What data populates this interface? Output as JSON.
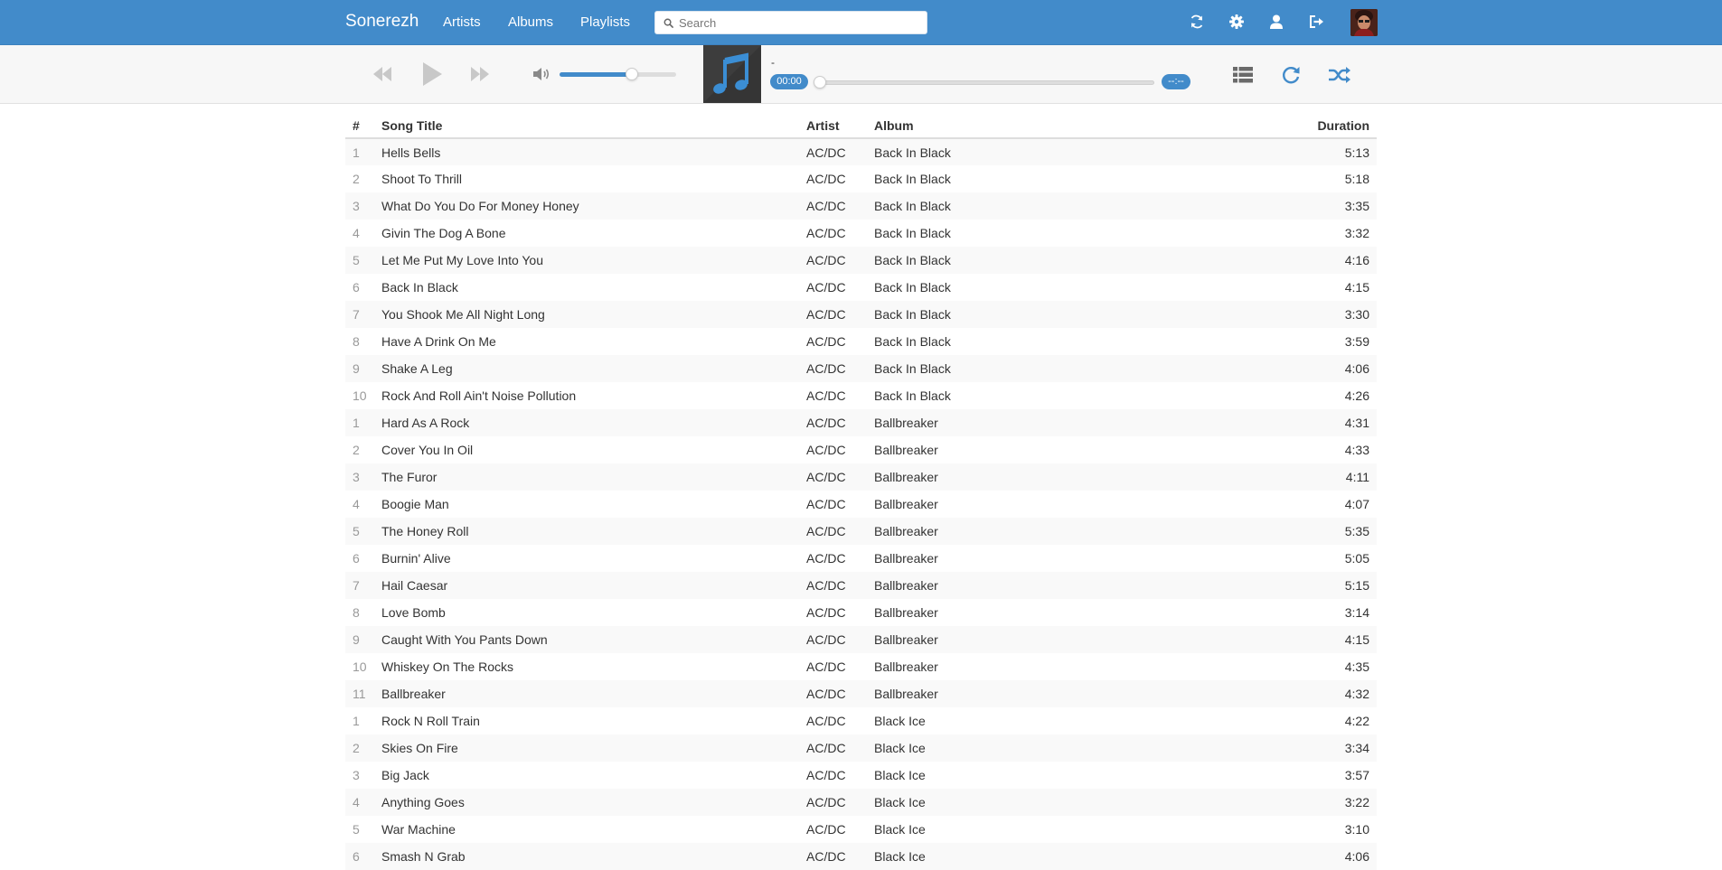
{
  "navbar": {
    "brand": "Sonerezh",
    "links": [
      "Artists",
      "Albums",
      "Playlists"
    ],
    "search_placeholder": "Search",
    "accent_color": "#428bca",
    "icons": [
      "sync-icon",
      "gear-icon",
      "user-icon",
      "logout-icon"
    ]
  },
  "player": {
    "current_title": "-",
    "elapsed": "00:00",
    "remaining": "--:--",
    "volume_percent": 62,
    "progress_percent": 0,
    "icons": [
      "rewind-icon",
      "play-icon",
      "fast-forward-icon",
      "volume-icon",
      "music-note-icon",
      "queue-list-icon",
      "repeat-icon",
      "shuffle-icon"
    ]
  },
  "table": {
    "headers": {
      "num": "#",
      "title": "Song Title",
      "artist": "Artist",
      "album": "Album",
      "duration": "Duration"
    },
    "rows": [
      {
        "num": "1",
        "title": "Hells Bells",
        "artist": "AC/DC",
        "album": "Back In Black",
        "duration": "5:13"
      },
      {
        "num": "2",
        "title": "Shoot To Thrill",
        "artist": "AC/DC",
        "album": "Back In Black",
        "duration": "5:18"
      },
      {
        "num": "3",
        "title": "What Do You Do For Money Honey",
        "artist": "AC/DC",
        "album": "Back In Black",
        "duration": "3:35"
      },
      {
        "num": "4",
        "title": "Givin The Dog A Bone",
        "artist": "AC/DC",
        "album": "Back In Black",
        "duration": "3:32"
      },
      {
        "num": "5",
        "title": "Let Me Put My Love Into You",
        "artist": "AC/DC",
        "album": "Back In Black",
        "duration": "4:16"
      },
      {
        "num": "6",
        "title": "Back In Black",
        "artist": "AC/DC",
        "album": "Back In Black",
        "duration": "4:15"
      },
      {
        "num": "7",
        "title": "You Shook Me All Night Long",
        "artist": "AC/DC",
        "album": "Back In Black",
        "duration": "3:30"
      },
      {
        "num": "8",
        "title": "Have A Drink On Me",
        "artist": "AC/DC",
        "album": "Back In Black",
        "duration": "3:59"
      },
      {
        "num": "9",
        "title": "Shake A Leg",
        "artist": "AC/DC",
        "album": "Back In Black",
        "duration": "4:06"
      },
      {
        "num": "10",
        "title": "Rock And Roll Ain't Noise Pollution",
        "artist": "AC/DC",
        "album": "Back In Black",
        "duration": "4:26"
      },
      {
        "num": "1",
        "title": "Hard As A Rock",
        "artist": "AC/DC",
        "album": "Ballbreaker",
        "duration": "4:31"
      },
      {
        "num": "2",
        "title": "Cover You In Oil",
        "artist": "AC/DC",
        "album": "Ballbreaker",
        "duration": "4:33"
      },
      {
        "num": "3",
        "title": "The Furor",
        "artist": "AC/DC",
        "album": "Ballbreaker",
        "duration": "4:11"
      },
      {
        "num": "4",
        "title": "Boogie Man",
        "artist": "AC/DC",
        "album": "Ballbreaker",
        "duration": "4:07"
      },
      {
        "num": "5",
        "title": "The Honey Roll",
        "artist": "AC/DC",
        "album": "Ballbreaker",
        "duration": "5:35"
      },
      {
        "num": "6",
        "title": "Burnin' Alive",
        "artist": "AC/DC",
        "album": "Ballbreaker",
        "duration": "5:05"
      },
      {
        "num": "7",
        "title": "Hail Caesar",
        "artist": "AC/DC",
        "album": "Ballbreaker",
        "duration": "5:15"
      },
      {
        "num": "8",
        "title": "Love Bomb",
        "artist": "AC/DC",
        "album": "Ballbreaker",
        "duration": "3:14"
      },
      {
        "num": "9",
        "title": "Caught With You Pants Down",
        "artist": "AC/DC",
        "album": "Ballbreaker",
        "duration": "4:15"
      },
      {
        "num": "10",
        "title": "Whiskey On The Rocks",
        "artist": "AC/DC",
        "album": "Ballbreaker",
        "duration": "4:35"
      },
      {
        "num": "11",
        "title": "Ballbreaker",
        "artist": "AC/DC",
        "album": "Ballbreaker",
        "duration": "4:32"
      },
      {
        "num": "1",
        "title": "Rock N Roll Train",
        "artist": "AC/DC",
        "album": "Black Ice",
        "duration": "4:22"
      },
      {
        "num": "2",
        "title": "Skies On Fire",
        "artist": "AC/DC",
        "album": "Black Ice",
        "duration": "3:34"
      },
      {
        "num": "3",
        "title": "Big Jack",
        "artist": "AC/DC",
        "album": "Black Ice",
        "duration": "3:57"
      },
      {
        "num": "4",
        "title": "Anything Goes",
        "artist": "AC/DC",
        "album": "Black Ice",
        "duration": "3:22"
      },
      {
        "num": "5",
        "title": "War Machine",
        "artist": "AC/DC",
        "album": "Black Ice",
        "duration": "3:10"
      },
      {
        "num": "6",
        "title": "Smash N Grab",
        "artist": "AC/DC",
        "album": "Black Ice",
        "duration": "4:06"
      }
    ]
  }
}
